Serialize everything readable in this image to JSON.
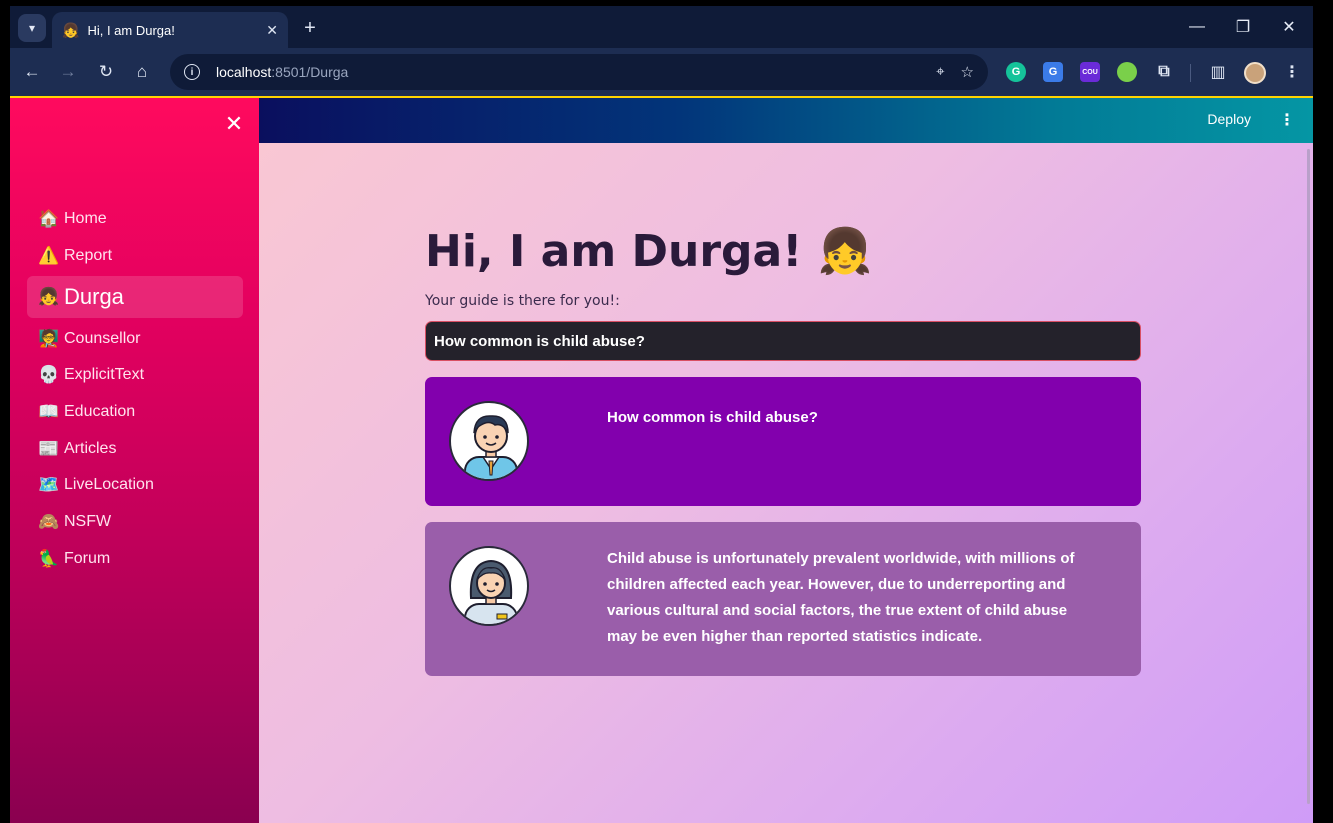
{
  "browser": {
    "tab_title": "Hi, I am Durga!",
    "tab_favicon": "👧",
    "url_host": "localhost",
    "url_path": ":8501/Durga",
    "new_tab_label": "+",
    "ext_grammarly": "G",
    "ext_translate": "G",
    "ext_coupon": "COU"
  },
  "app": {
    "deploy_label": "Deploy",
    "sidebar": {
      "items": [
        {
          "icon": "🏠",
          "label": "Home"
        },
        {
          "icon": "⚠️",
          "label": "Report"
        },
        {
          "icon": "👧",
          "label": "Durga"
        },
        {
          "icon": "🧑‍🏫",
          "label": "Counsellor"
        },
        {
          "icon": "💀",
          "label": "ExplicitText"
        },
        {
          "icon": "📖",
          "label": "Education"
        },
        {
          "icon": "📰",
          "label": "Articles"
        },
        {
          "icon": "🗺️",
          "label": "LiveLocation"
        },
        {
          "icon": "🙈",
          "label": "NSFW"
        },
        {
          "icon": "🦜",
          "label": "Forum"
        }
      ]
    },
    "main": {
      "title": "Hi, I am Durga! 👧",
      "subtitle": "Your guide is there for you!:",
      "query_value": "How common is child abuse?",
      "user_message": "How common is child abuse?",
      "bot_message": "Child abuse is unfortunately prevalent worldwide, with millions of children affected each year. However, due to underreporting and various cultural and social factors, the true extent of child abuse may be even higher than reported statistics indicate."
    }
  },
  "colors": {
    "sidebar_top": "#ff0a5e",
    "header_start": "#0a0f5e",
    "user_bubble": "#8200ad",
    "bot_bubble": "#9a5eaa"
  }
}
